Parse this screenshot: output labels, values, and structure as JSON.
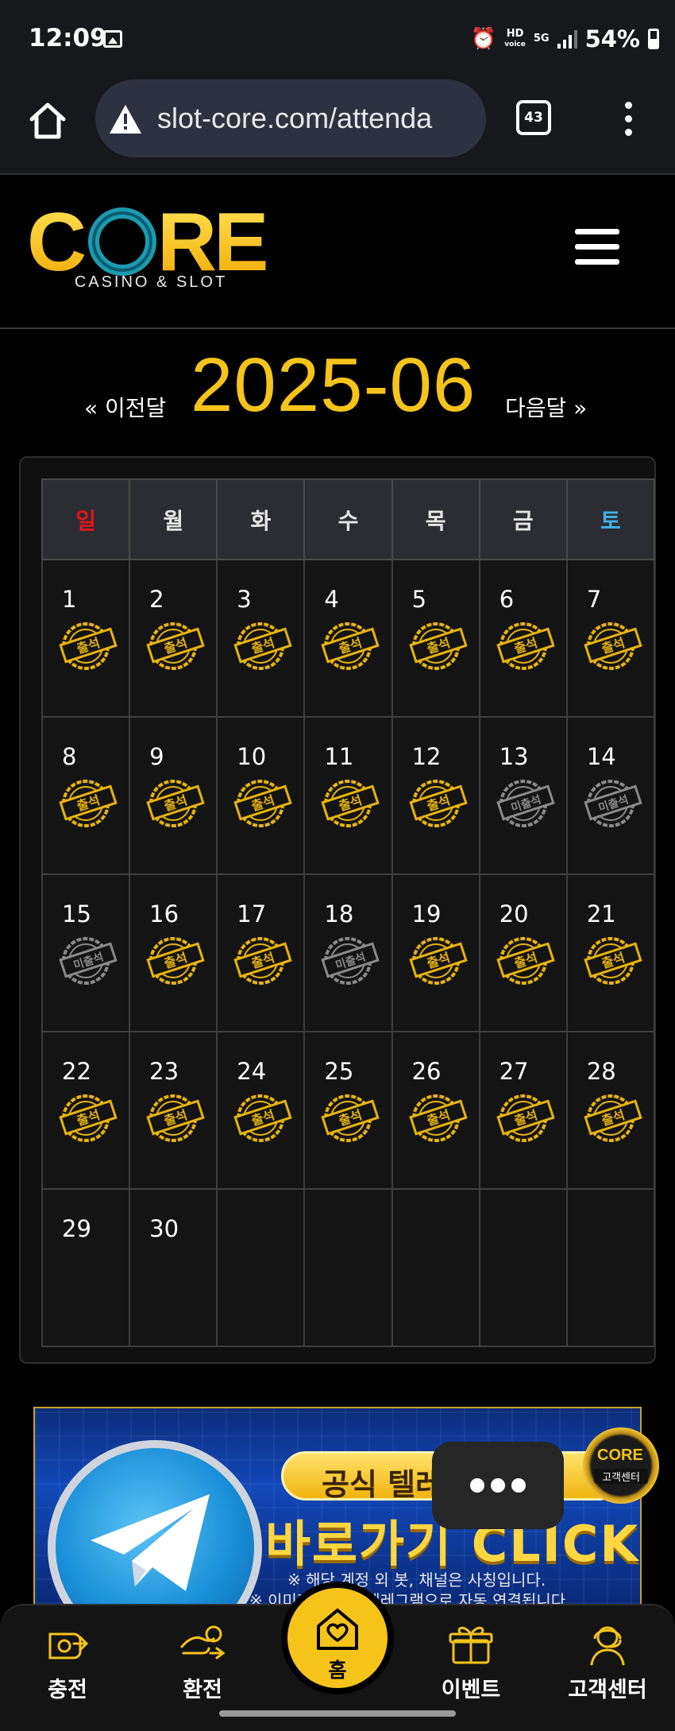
{
  "status_bar": {
    "time": "12:09",
    "net_hd": "HD",
    "net_voice": "voice",
    "net_5g": "5G",
    "battery": "54%"
  },
  "browser": {
    "url": "slot-core.com/attenda",
    "tab_count": "43"
  },
  "site": {
    "logo_text": "CORE",
    "logo_sub": "CASINO & SLOT"
  },
  "calendar": {
    "prev_label": "« 이전달",
    "next_label": "다음달 »",
    "month": "2025-06",
    "weekdays": [
      "일",
      "월",
      "화",
      "수",
      "목",
      "금",
      "토"
    ],
    "attended_label": "출석",
    "missed_label": "미출석",
    "weeks": [
      [
        {
          "day": "1",
          "status": "attended"
        },
        {
          "day": "2",
          "status": "attended"
        },
        {
          "day": "3",
          "status": "attended"
        },
        {
          "day": "4",
          "status": "attended"
        },
        {
          "day": "5",
          "status": "attended"
        },
        {
          "day": "6",
          "status": "attended"
        },
        {
          "day": "7",
          "status": "attended"
        }
      ],
      [
        {
          "day": "8",
          "status": "attended"
        },
        {
          "day": "9",
          "status": "attended"
        },
        {
          "day": "10",
          "status": "attended"
        },
        {
          "day": "11",
          "status": "attended"
        },
        {
          "day": "12",
          "status": "attended"
        },
        {
          "day": "13",
          "status": "missed"
        },
        {
          "day": "14",
          "status": "missed"
        }
      ],
      [
        {
          "day": "15",
          "status": "missed"
        },
        {
          "day": "16",
          "status": "attended"
        },
        {
          "day": "17",
          "status": "attended"
        },
        {
          "day": "18",
          "status": "missed"
        },
        {
          "day": "19",
          "status": "attended"
        },
        {
          "day": "20",
          "status": "attended"
        },
        {
          "day": "21",
          "status": "attended"
        }
      ],
      [
        {
          "day": "22",
          "status": "attended"
        },
        {
          "day": "23",
          "status": "attended"
        },
        {
          "day": "24",
          "status": "attended"
        },
        {
          "day": "25",
          "status": "attended"
        },
        {
          "day": "26",
          "status": "attended"
        },
        {
          "day": "27",
          "status": "attended"
        },
        {
          "day": "28",
          "status": "attended"
        }
      ],
      [
        {
          "day": "29",
          "status": "none"
        },
        {
          "day": "30",
          "status": "none"
        },
        {
          "day": "",
          "status": "none"
        },
        {
          "day": "",
          "status": "none"
        },
        {
          "day": "",
          "status": "none"
        },
        {
          "day": "",
          "status": "none"
        },
        {
          "day": "",
          "status": "none"
        }
      ]
    ]
  },
  "banner": {
    "pill_text": "공식 텔레그램 채널",
    "big_text": "바로가기 CLICK",
    "note1": "※ 해당 계정 외 봇, 채널은 사칭입니다.",
    "note2": "※ 이미지 클릭시 텔레그램으로 자동 연결됩니다."
  },
  "cs_badge": {
    "logo": "CORE",
    "label": "고객센터"
  },
  "bottom_nav": {
    "deposit": "충전",
    "withdraw": "환전",
    "home": "홈",
    "event": "이벤트",
    "support": "고객센터"
  },
  "colors": {
    "accent_gold": "#f5c31a",
    "sunday_red": "#e0161b",
    "saturday_blue": "#3fb3e6",
    "stamp_attended": "#e8b40c",
    "stamp_missed": "#8a8a8a"
  }
}
